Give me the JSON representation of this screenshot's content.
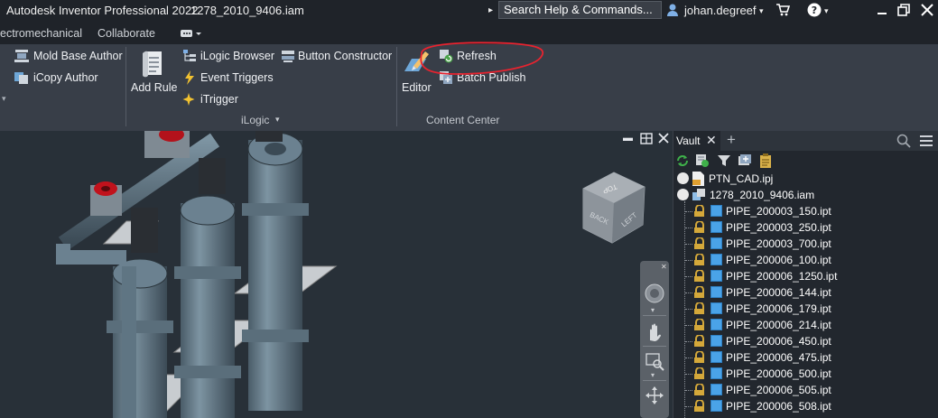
{
  "titlebar": {
    "app_title": "Autodesk Inventor Professional 2022",
    "file_name": "1278_2010_9406.iam",
    "search_placeholder": "Search Help & Commands...",
    "user": "johan.degreef"
  },
  "tabs": [
    "ectromechanical",
    "Collaborate"
  ],
  "ribbon": {
    "mold_base_author": "Mold Base Author",
    "icopy_author": "iCopy Author",
    "add_rule": "Add Rule",
    "ilogic_browser": "iLogic Browser",
    "event_triggers": "Event Triggers",
    "itrigger": "iTrigger",
    "button_constructor": "Button Constructor",
    "ilogic_panel": "iLogic",
    "editor": "Editor",
    "refresh": "Refresh",
    "batch_publish": "Batch Publish",
    "content_center_panel": "Content Center"
  },
  "viewcube": {
    "top": "TOP",
    "back": "BACK",
    "left": "LEFT"
  },
  "vault": {
    "tab_label": "Vault",
    "project": "PTN_CAD.ipj",
    "assembly": "1278_2010_9406.iam",
    "parts": [
      "PIPE_200003_150.ipt",
      "PIPE_200003_250.ipt",
      "PIPE_200003_700.ipt",
      "PIPE_200006_100.ipt",
      "PIPE_200006_1250.ipt",
      "PIPE_200006_144.ipt",
      "PIPE_200006_179.ipt",
      "PIPE_200006_214.ipt",
      "PIPE_200006_450.ipt",
      "PIPE_200006_475.ipt",
      "PIPE_200006_500.ipt",
      "PIPE_200006_505.ipt",
      "PIPE_200006_508.ipt"
    ]
  },
  "colors": {
    "accent": "#e8232f",
    "part_icon": "#4aa3e8",
    "lock": "#d4a83a"
  }
}
